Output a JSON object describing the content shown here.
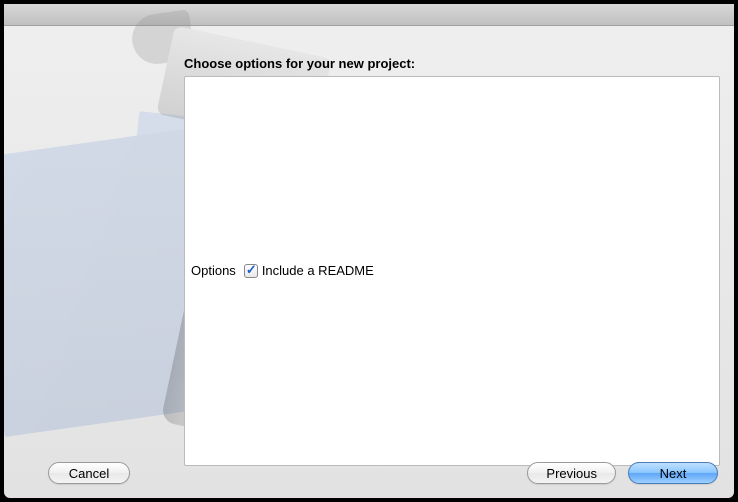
{
  "heading": "Choose options for your new project:",
  "options": {
    "label": "Options",
    "readme": {
      "label": "Include a README",
      "checked": true
    }
  },
  "buttons": {
    "cancel": "Cancel",
    "previous": "Previous",
    "next": "Next"
  }
}
